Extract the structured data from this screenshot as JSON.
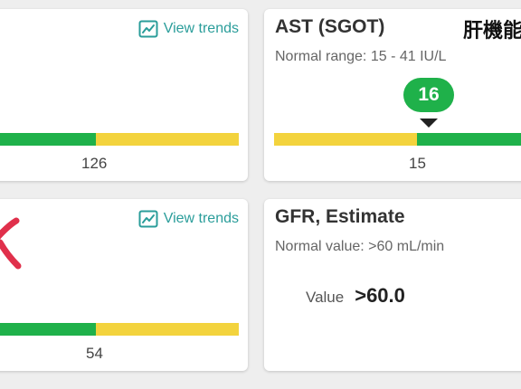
{
  "cards": {
    "top_left": {
      "trends_label": "View trends",
      "tick": "126"
    },
    "ast": {
      "title": "AST (SGOT)",
      "cjk_label": "肝機能",
      "range": "Normal range: 15 - 41 IU/L",
      "value": "16",
      "tick": "15"
    },
    "bottom_left": {
      "trends_label": "View trends",
      "tick": "54"
    },
    "gfr": {
      "title": "GFR, Estimate",
      "range": "Normal value: >60 mL/min",
      "value_label": "Value",
      "value": ">60.0"
    }
  },
  "colors": {
    "normal": "#1fb14a",
    "caution": "#f3d33d",
    "link": "#2a9d9a",
    "mark": "#e0304b"
  },
  "icons": [
    "trend-chart-icon",
    "handwritten-mark"
  ]
}
